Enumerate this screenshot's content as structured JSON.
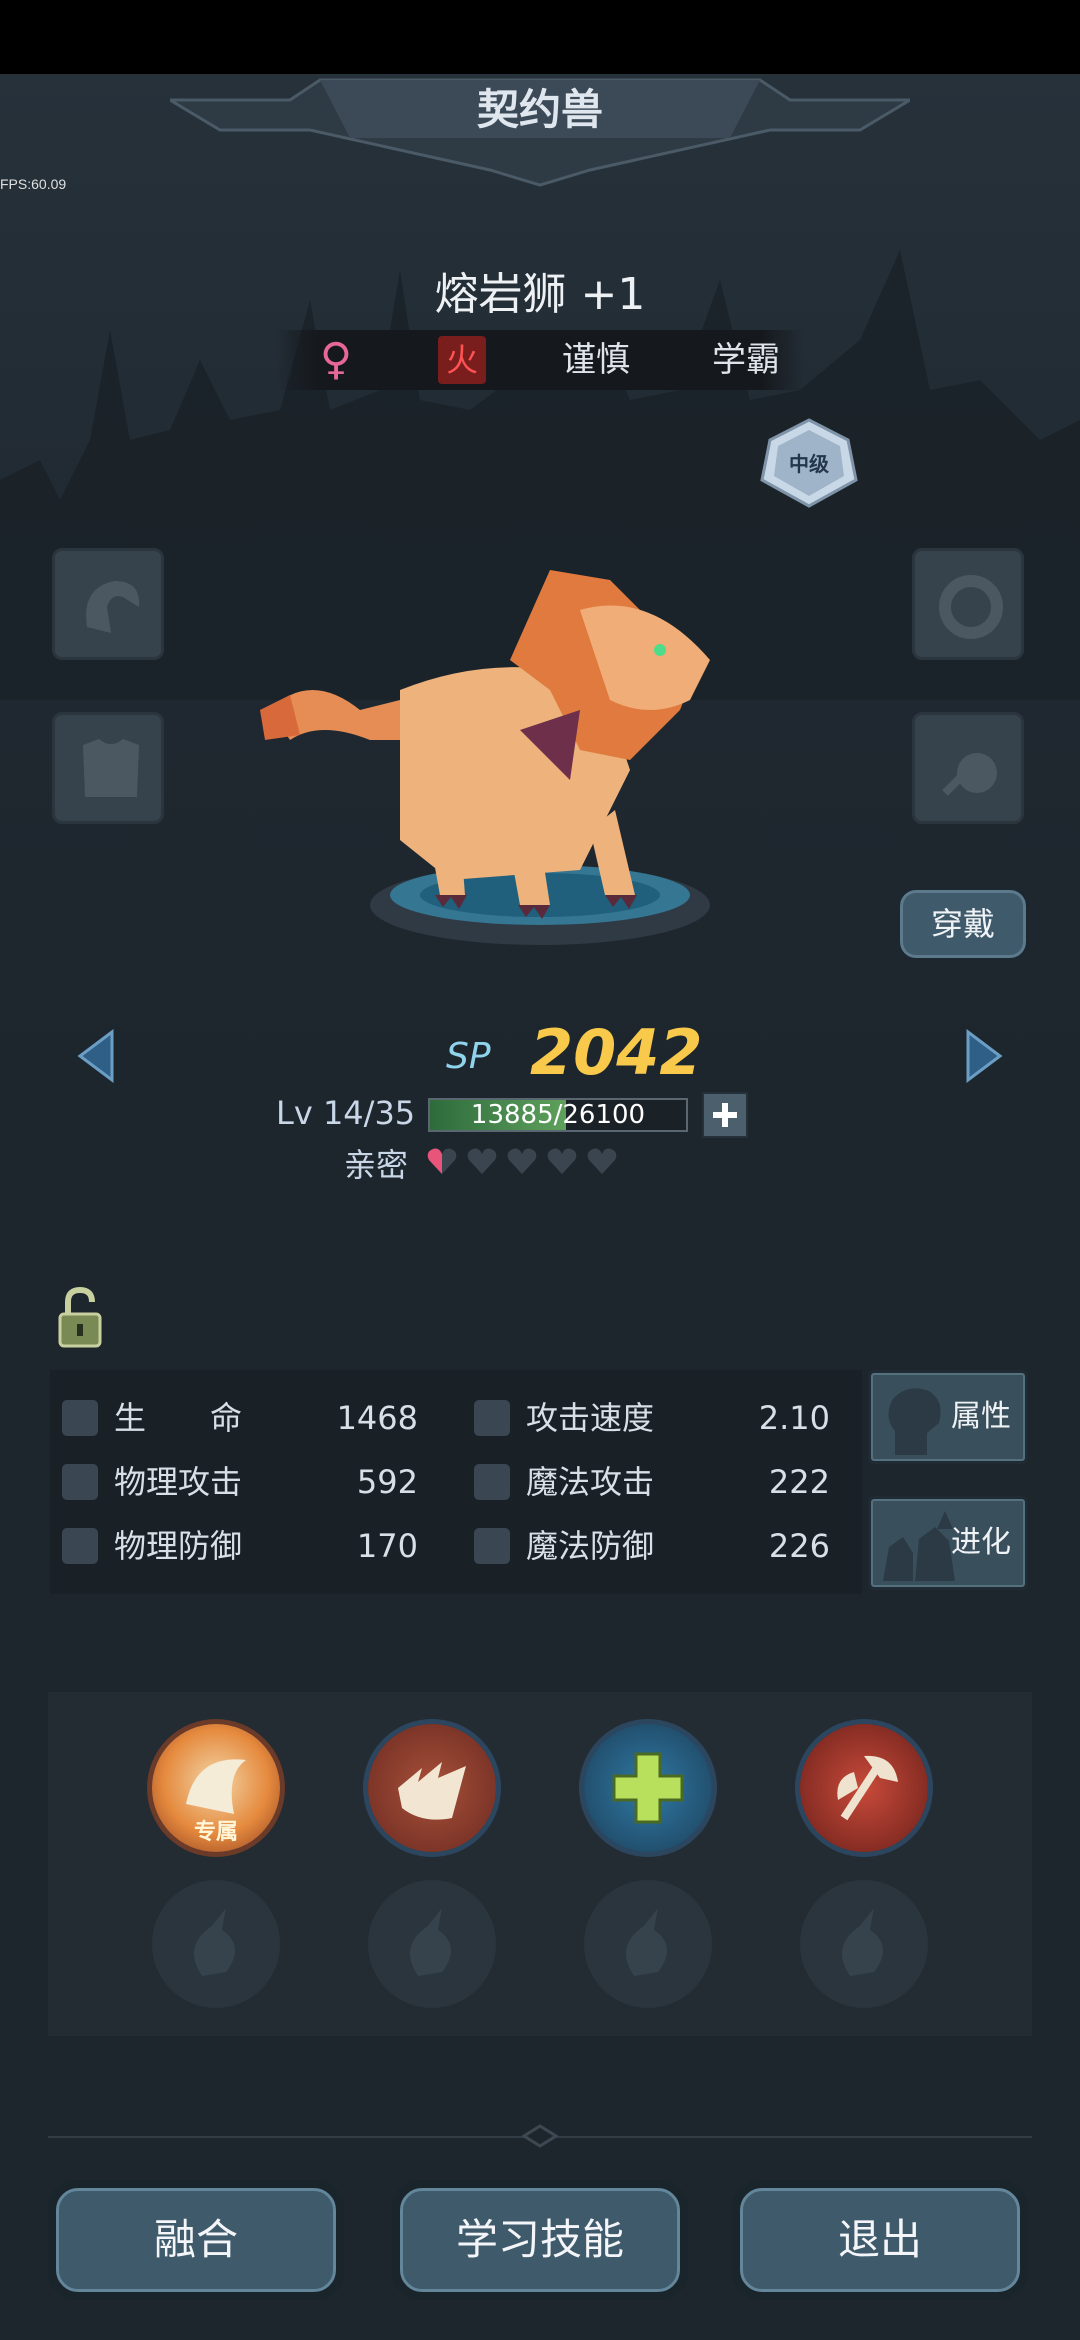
{
  "screen": {
    "title": "契约兽",
    "fps_text": "FPS:60.09"
  },
  "pet": {
    "name": "熔岩狮 +1",
    "gender_symbol": "♀",
    "element": "火",
    "traits": [
      "谨慎",
      "学霸"
    ],
    "rank": "中级"
  },
  "actions": {
    "wear_label": "穿戴"
  },
  "power": {
    "sp_label": "SP",
    "sp_value": "2042"
  },
  "level": {
    "label": "Lv 14/35",
    "xp_text": "13885/26100",
    "xp_current": 13885,
    "xp_max": 26100
  },
  "intimacy": {
    "label": "亲密",
    "hearts_filled_fraction": 0.5,
    "hearts_total": 5
  },
  "stats": [
    {
      "name": "生　　命",
      "value": "1468",
      "icon": "heart-icon"
    },
    {
      "name": "攻击速度",
      "value": "2.10",
      "icon": "boot-icon"
    },
    {
      "name": "物理攻击",
      "value": "592",
      "icon": "sword-icon"
    },
    {
      "name": "魔法攻击",
      "value": "222",
      "icon": "wand-icon"
    },
    {
      "name": "物理防御",
      "value": "170",
      "icon": "shield-icon"
    },
    {
      "name": "魔法防御",
      "value": "226",
      "icon": "magic-shield-icon"
    }
  ],
  "side_buttons": {
    "attributes_label": "属性",
    "evolve_label": "进化"
  },
  "skills": {
    "exclusive_tag": "专属"
  },
  "bottom": {
    "fuse_label": "融合",
    "learn_label": "学习技能",
    "exit_label": "退出"
  },
  "colors": {
    "background": "#1e262d",
    "button": "#3f5a6b",
    "sp_gold": "#f8c94a",
    "sp_blue": "#8fd3ec",
    "element_red": "#ff5252",
    "gender_pink": "#e8679b"
  }
}
